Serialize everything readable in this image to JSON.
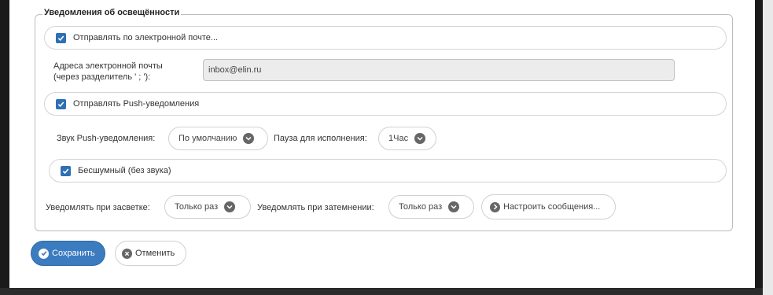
{
  "section": {
    "legend": "Уведомления об освещённости"
  },
  "email": {
    "checkbox_label": "Отправлять по электронной почте...",
    "checked": true,
    "address_label_line1": "Адреса электронной почты",
    "address_label_line2": "(через разделитель ' ; '):",
    "address_value": "inbox@elin.ru"
  },
  "push": {
    "checkbox_label": "Отправлять Push-уведомления",
    "checked": true,
    "sound_label": "Звук Push-уведомления:",
    "sound_value": "По умолчанию",
    "pause_label": "Пауза для исполнения:",
    "pause_value": "1Час",
    "silent_label": "Бесшумный (без звука)",
    "silent_checked": true
  },
  "notify": {
    "light_label": "Уведомлять при засветке:",
    "light_value": "Только раз",
    "dark_label": "Уведомлять при затемнении:",
    "dark_value": "Только раз",
    "configure_label": "Настроить сообщения..."
  },
  "actions": {
    "save_label": "Сохранить",
    "cancel_label": "Отменить"
  },
  "colors": {
    "accent": "#3b7bbf",
    "checkbox": "#2f6fb4"
  }
}
